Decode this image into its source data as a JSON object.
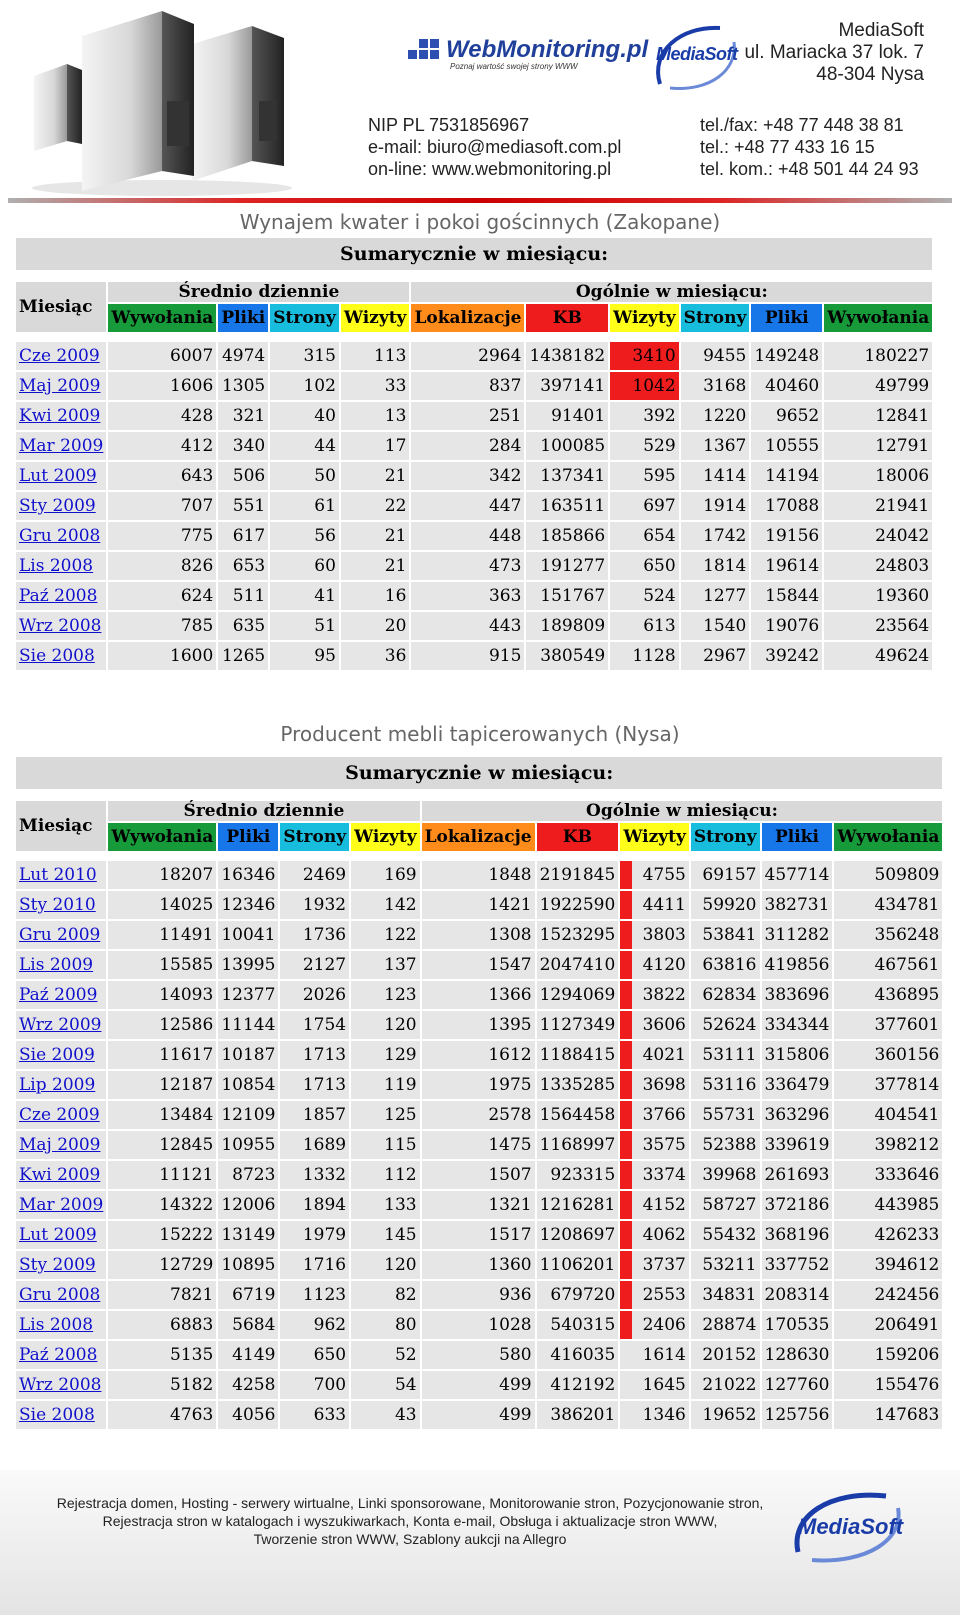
{
  "header": {
    "webmonitoring_logo": "WebMonitoring.pl",
    "webmonitoring_tagline": "Poznaj wartość swojej strony WWW",
    "mediasoft_logo": "MediaSoft",
    "address": [
      "MediaSoft",
      "ul. Mariacka 37 lok. 7",
      "48-304 Nysa"
    ],
    "contact_left": [
      "NIP PL 7531856967",
      "e-mail: biuro@mediasoft.com.pl",
      "on-line: www.webmonitoring.pl"
    ],
    "contact_right": [
      "tel./fax: +48 77 448 38 81",
      "tel.: +48 77 433 16 15",
      "tel. kom.: +48 501 44 24 93"
    ]
  },
  "colors": {
    "green": "#179a3a",
    "blue": "#1877e8",
    "cyan": "#18bcdc",
    "yellow": "#ffff1a",
    "orange": "#ff8c1a",
    "red": "#ee1c1c",
    "header_red_line": "#cc0000"
  },
  "tables": [
    {
      "title": "Wynajem kwater i pokoi gościnnych (Zakopane)",
      "summary_label": "Sumarycznie w miesiącu:",
      "month_label": "Miesiąc",
      "daily_label": "Średnio dziennie",
      "monthly_label": "Ogólnie w miesiącu:",
      "columns": [
        "Wywołania",
        "Pliki",
        "Strony",
        "Wizyty",
        "Lokalizacje",
        "KB",
        "Wizyty",
        "Strony",
        "Pliki",
        "Wywołania"
      ],
      "highlight_red": [
        [
          0,
          7
        ],
        [
          1,
          7
        ]
      ],
      "rows": [
        [
          "Cze 2009",
          "6007",
          "4974",
          "315",
          "113",
          "2964",
          "1438182",
          "3410",
          "9455",
          "149248",
          "180227"
        ],
        [
          "Maj 2009",
          "1606",
          "1305",
          "102",
          "33",
          "837",
          "397141",
          "1042",
          "3168",
          "40460",
          "49799"
        ],
        [
          "Kwi 2009",
          "428",
          "321",
          "40",
          "13",
          "251",
          "91401",
          "392",
          "1220",
          "9652",
          "12841"
        ],
        [
          "Mar 2009",
          "412",
          "340",
          "44",
          "17",
          "284",
          "100085",
          "529",
          "1367",
          "10555",
          "12791"
        ],
        [
          "Lut 2009",
          "643",
          "506",
          "50",
          "21",
          "342",
          "137341",
          "595",
          "1414",
          "14194",
          "18006"
        ],
        [
          "Sty 2009",
          "707",
          "551",
          "61",
          "22",
          "447",
          "163511",
          "697",
          "1914",
          "17088",
          "21941"
        ],
        [
          "Gru 2008",
          "775",
          "617",
          "56",
          "21",
          "448",
          "185866",
          "654",
          "1742",
          "19156",
          "24042"
        ],
        [
          "Lis 2008",
          "826",
          "653",
          "60",
          "21",
          "473",
          "191277",
          "650",
          "1814",
          "19614",
          "24803"
        ],
        [
          "Paź 2008",
          "624",
          "511",
          "41",
          "16",
          "363",
          "151767",
          "524",
          "1277",
          "15844",
          "19360"
        ],
        [
          "Wrz 2008",
          "785",
          "635",
          "51",
          "20",
          "443",
          "189809",
          "613",
          "1540",
          "19076",
          "23564"
        ],
        [
          "Sie 2008",
          "1600",
          "1265",
          "95",
          "36",
          "915",
          "380549",
          "1128",
          "2967",
          "39242",
          "49624"
        ]
      ]
    },
    {
      "title": "Producent mebli tapicerowanych (Nysa)",
      "summary_label": "Sumarycznie w miesiącu:",
      "month_label": "Miesiąc",
      "daily_label": "Średnio dziennie",
      "monthly_label": "Ogólnie w miesiącu:",
      "columns": [
        "Wywołania",
        "Pliki",
        "Strony",
        "Wizyty",
        "Lokalizacje",
        "KB",
        "Wizyty",
        "Strony",
        "Pliki",
        "Wywołania"
      ],
      "highlight_bar_rows": 16,
      "rows": [
        [
          "Lut 2010",
          "18207",
          "16346",
          "2469",
          "169",
          "1848",
          "2191845",
          "4755",
          "69157",
          "457714",
          "509809"
        ],
        [
          "Sty 2010",
          "14025",
          "12346",
          "1932",
          "142",
          "1421",
          "1922590",
          "4411",
          "59920",
          "382731",
          "434781"
        ],
        [
          "Gru 2009",
          "11491",
          "10041",
          "1736",
          "122",
          "1308",
          "1523295",
          "3803",
          "53841",
          "311282",
          "356248"
        ],
        [
          "Lis 2009",
          "15585",
          "13995",
          "2127",
          "137",
          "1547",
          "2047410",
          "4120",
          "63816",
          "419856",
          "467561"
        ],
        [
          "Paź 2009",
          "14093",
          "12377",
          "2026",
          "123",
          "1366",
          "1294069",
          "3822",
          "62834",
          "383696",
          "436895"
        ],
        [
          "Wrz 2009",
          "12586",
          "11144",
          "1754",
          "120",
          "1395",
          "1127349",
          "3606",
          "52624",
          "334344",
          "377601"
        ],
        [
          "Sie 2009",
          "11617",
          "10187",
          "1713",
          "129",
          "1612",
          "1188415",
          "4021",
          "53111",
          "315806",
          "360156"
        ],
        [
          "Lip 2009",
          "12187",
          "10854",
          "1713",
          "119",
          "1975",
          "1335285",
          "3698",
          "53116",
          "336479",
          "377814"
        ],
        [
          "Cze 2009",
          "13484",
          "12109",
          "1857",
          "125",
          "2578",
          "1564458",
          "3766",
          "55731",
          "363296",
          "404541"
        ],
        [
          "Maj 2009",
          "12845",
          "10955",
          "1689",
          "115",
          "1475",
          "1168997",
          "3575",
          "52388",
          "339619",
          "398212"
        ],
        [
          "Kwi 2009",
          "11121",
          "8723",
          "1332",
          "112",
          "1507",
          "923315",
          "3374",
          "39968",
          "261693",
          "333646"
        ],
        [
          "Mar 2009",
          "14322",
          "12006",
          "1894",
          "133",
          "1321",
          "1216281",
          "4152",
          "58727",
          "372186",
          "443985"
        ],
        [
          "Lut 2009",
          "15222",
          "13149",
          "1979",
          "145",
          "1517",
          "1208697",
          "4062",
          "55432",
          "368196",
          "426233"
        ],
        [
          "Sty 2009",
          "12729",
          "10895",
          "1716",
          "120",
          "1360",
          "1106201",
          "3737",
          "53211",
          "337752",
          "394612"
        ],
        [
          "Gru 2008",
          "7821",
          "6719",
          "1123",
          "82",
          "936",
          "679720",
          "2553",
          "34831",
          "208314",
          "242456"
        ],
        [
          "Lis 2008",
          "6883",
          "5684",
          "962",
          "80",
          "1028",
          "540315",
          "2406",
          "28874",
          "170535",
          "206491"
        ],
        [
          "Paź 2008",
          "5135",
          "4149",
          "650",
          "52",
          "580",
          "416035",
          "1614",
          "20152",
          "128630",
          "159206"
        ],
        [
          "Wrz 2008",
          "5182",
          "4258",
          "700",
          "54",
          "499",
          "412192",
          "1645",
          "21022",
          "127760",
          "155476"
        ],
        [
          "Sie 2008",
          "4763",
          "4056",
          "633",
          "43",
          "499",
          "386201",
          "1346",
          "19652",
          "125756",
          "147683"
        ]
      ]
    }
  ],
  "footer": {
    "lines": [
      "Rejestracja domen, Hosting - serwery wirtualne, Linki sponsorowane, Monitorowanie stron, Pozycjonowanie stron,",
      "Rejestracja stron w katalogach i wyszukiwarkach, Konta e-mail, Obsługa i aktualizacje stron WWW,",
      "Tworzenie stron WWW,  Szablony aukcji na Allegro"
    ],
    "logo": "MediaSoft"
  }
}
